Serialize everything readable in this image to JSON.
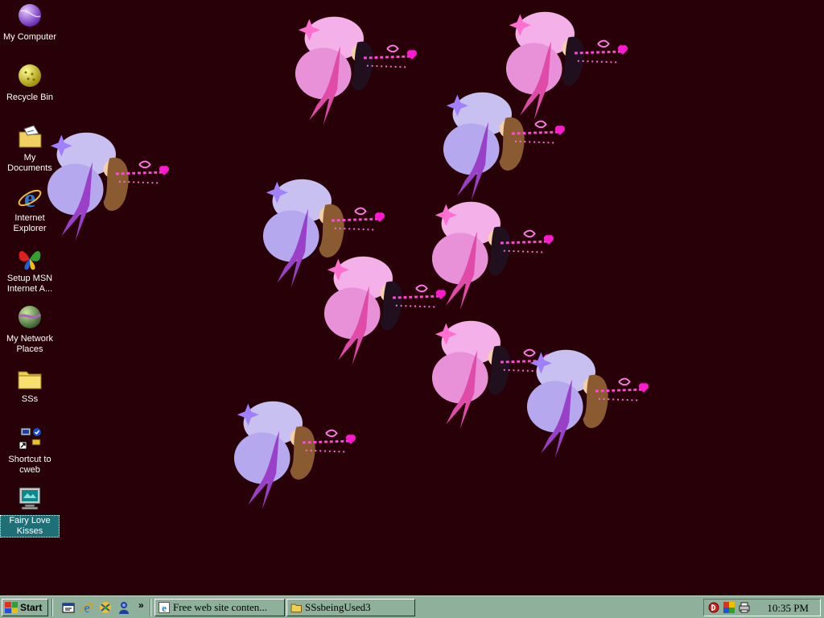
{
  "desktop": {
    "background_color": "#280008",
    "icons": [
      {
        "label": "My Computer",
        "icon": "my-computer-icon"
      },
      {
        "label": "Recycle Bin",
        "icon": "recycle-bin-icon"
      },
      {
        "label": "My Documents",
        "icon": "my-documents-icon"
      },
      {
        "label": "Internet Explorer",
        "icon": "internet-explorer-icon"
      },
      {
        "label": "Setup MSN Internet A...",
        "icon": "msn-butterfly-icon"
      },
      {
        "label": "My Network Places",
        "icon": "network-places-icon"
      },
      {
        "label": "SSs",
        "icon": "folder-icon"
      },
      {
        "label": "Shortcut to cweb",
        "icon": "shortcut-network-icon"
      },
      {
        "label": "Fairy Love Kisses",
        "icon": "screensaver-monitor-icon",
        "selected": true
      }
    ]
  },
  "taskbar": {
    "start_label": "Start",
    "quick_launch": [
      "show-desktop-icon",
      "internet-explorer-icon",
      "media-icon",
      "messenger-icon"
    ],
    "overflow": "»",
    "tasks": [
      {
        "label": "Free web site conten...",
        "icon": "internet-explorer-icon"
      },
      {
        "label": "SSsbeingUsed3",
        "icon": "folder-icon"
      }
    ],
    "tray_icons": [
      "antivirus-icon",
      "network-status-icon",
      "printer-icon"
    ],
    "clock": "10:35 PM",
    "color": "#8fb09b"
  }
}
